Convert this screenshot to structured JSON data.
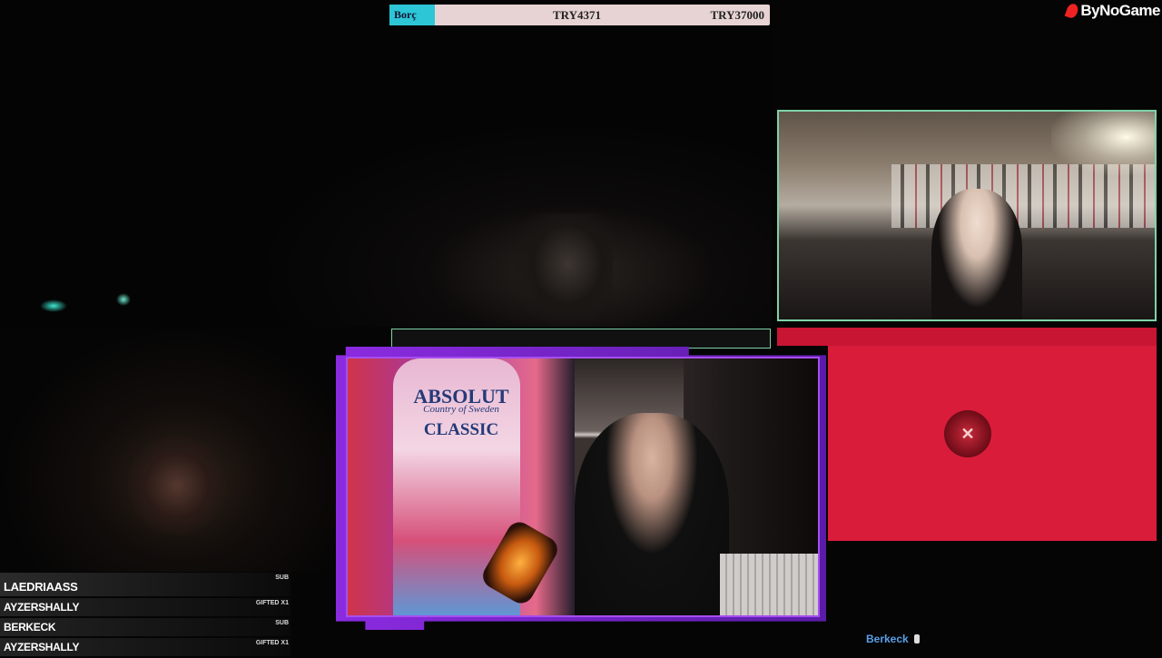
{
  "debt": {
    "label": "Borç",
    "current": "TRY4371",
    "target": "TRY37000",
    "label_color": "#2cc6d6"
  },
  "brand": {
    "name": "ByNoGame"
  },
  "bottle": {
    "brand": "ABSOLUT",
    "subtitle": "Country of Sweden",
    "variant": "CLASSIC"
  },
  "sub_feed": [
    {
      "name": "LAEDRIAASS",
      "type": "SUB"
    },
    {
      "name": "AYZERSHALLY",
      "type": "GIFTED X1"
    },
    {
      "name": "BERKECK",
      "type": "SUB"
    },
    {
      "name": "AYZERSHALLY",
      "type": "GIFTED X1"
    }
  ],
  "footer": {
    "username": "Berkeck"
  },
  "colors": {
    "panel_red": "#d91c3a",
    "frame_purple": "#a64ef0",
    "frame_green": "#7fd2a8"
  }
}
